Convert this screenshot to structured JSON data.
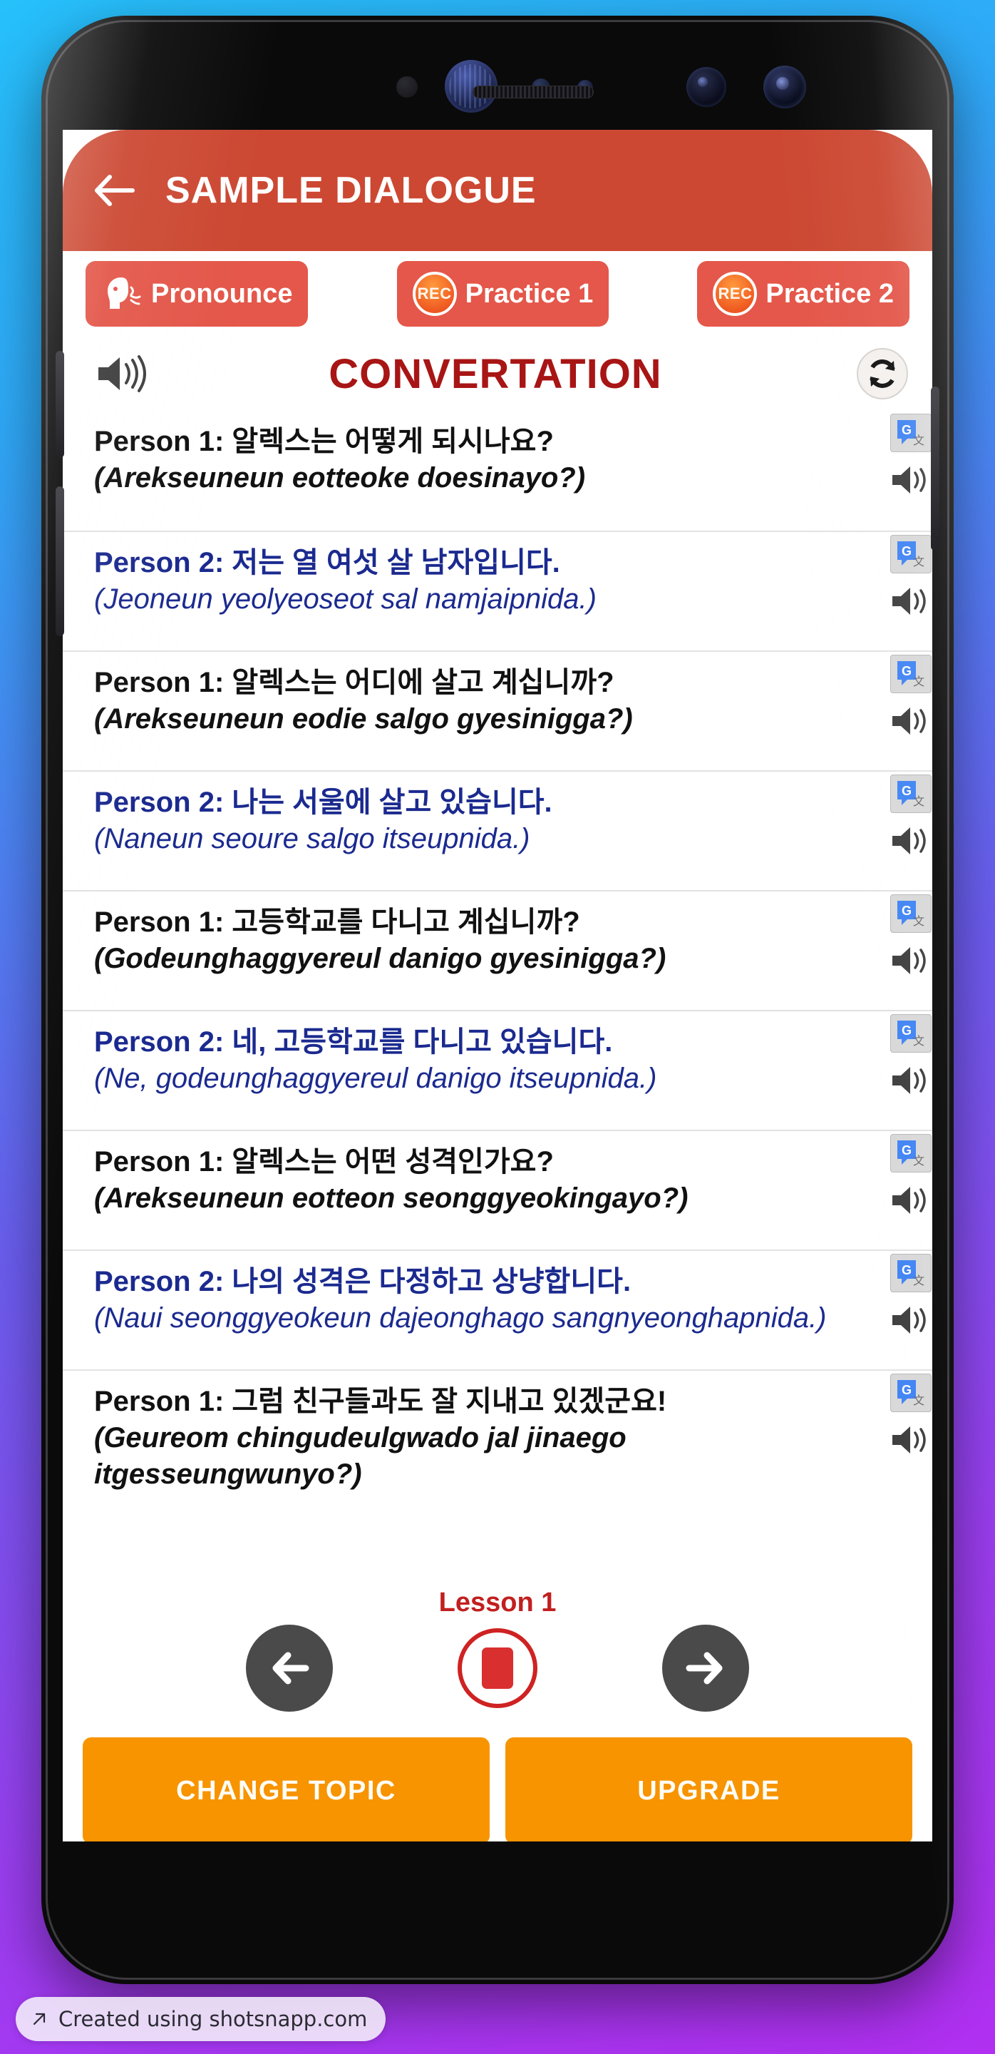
{
  "header": {
    "title": "SAMPLE DIALOGUE",
    "back_icon": "back-arrow-icon",
    "bg_color": "#cc4832"
  },
  "toolbar": {
    "buttons": [
      {
        "label": "Pronounce",
        "icon": "speaking-head-icon"
      },
      {
        "label": "Practice 1",
        "icon": "rec-icon",
        "icon_text": "REC"
      },
      {
        "label": "Practice 2",
        "icon": "rec-icon",
        "icon_text": "REC"
      }
    ],
    "button_color": "#e4574a"
  },
  "conversation": {
    "title": "CONVERTATION",
    "title_color": "#a81515",
    "speaker_icon": "speaker-icon",
    "refresh_icon": "refresh-icon"
  },
  "dialogue": [
    {
      "speaker": "Person 1:",
      "person": 1,
      "korean": "알렉스는 어떻게 되시나요?",
      "romanized": "(Arekseuneun eotteoke doesinayo?)"
    },
    {
      "speaker": "Person 2:",
      "person": 2,
      "korean": "저는 열 여섯 살 남자입니다.",
      "romanized": "(Jeoneun yeolyeoseot sal namjaipnida.)"
    },
    {
      "speaker": "Person 1:",
      "person": 1,
      "korean": "알렉스는 어디에 살고 계십니까?",
      "romanized": "(Arekseuneun eodie salgo gyesinigga?)"
    },
    {
      "speaker": "Person 2:",
      "person": 2,
      "korean": "나는 서울에 살고 있습니다.",
      "romanized": "(Naneun seoure salgo itseupnida.)"
    },
    {
      "speaker": "Person 1:",
      "person": 1,
      "korean": "고등학교를 다니고 계십니까?",
      "romanized": "(Godeunghaggyereul danigo gyesinigga?)"
    },
    {
      "speaker": "Person 2:",
      "person": 2,
      "korean": "네, 고등학교를 다니고 있습니다.",
      "romanized": "(Ne, godeunghaggyereul danigo itseupnida.)"
    },
    {
      "speaker": "Person 1:",
      "person": 1,
      "korean": "알렉스는 어떤 성격인가요?",
      "romanized": "(Arekseuneun eotteon seonggyeokingayo?)"
    },
    {
      "speaker": "Person 2:",
      "person": 2,
      "korean": "나의 성격은 다정하고 상냥합니다.",
      "romanized": "(Naui seonggyeokeun dajeonghago sangnyeonghapnida.)"
    },
    {
      "speaker": "Person 1:",
      "person": 1,
      "korean": "그럼 친구들과도 잘 지내고 있겠군요!",
      "romanized": "(Geureom chingudeulgwado jal jinaego itgesseungwunyo?)"
    }
  ],
  "row_icons": {
    "translate_icon": "google-translate-icon",
    "speaker_icon": "speaker-icon"
  },
  "player": {
    "prev_icon": "arrow-left-icon",
    "next_icon": "arrow-right-icon",
    "stop_icon": "stop-icon",
    "lesson_label": "Lesson 1",
    "lesson_color": "#c21f1f"
  },
  "bottom": {
    "change_topic_label": "CHANGE TOPIC",
    "upgrade_label": "UPGRADE",
    "button_color": "#f79400"
  },
  "android_nav": {
    "back_icon": "triangle-back-icon",
    "home_icon": "circle-home-icon",
    "recents_icon": "square-recents-icon"
  },
  "watermark": {
    "text": "Created using shotsnapp.com",
    "icon": "external-link-arrow-icon"
  }
}
